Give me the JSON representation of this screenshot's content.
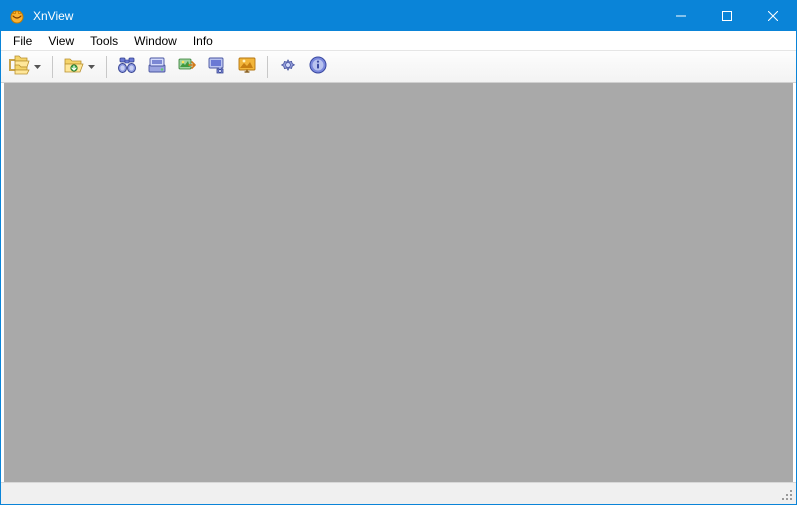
{
  "window": {
    "title": "XnView"
  },
  "menubar": {
    "items": [
      "File",
      "View",
      "Tools",
      "Window",
      "Info"
    ]
  },
  "toolbar": {
    "browse_label": "Browse",
    "open_label": "Open",
    "search_label": "Search",
    "scan_label": "Acquire",
    "convert_label": "Batch Convert",
    "capture_label": "Capture",
    "slideshow_label": "Slideshow",
    "options_label": "Options",
    "about_label": "About"
  }
}
